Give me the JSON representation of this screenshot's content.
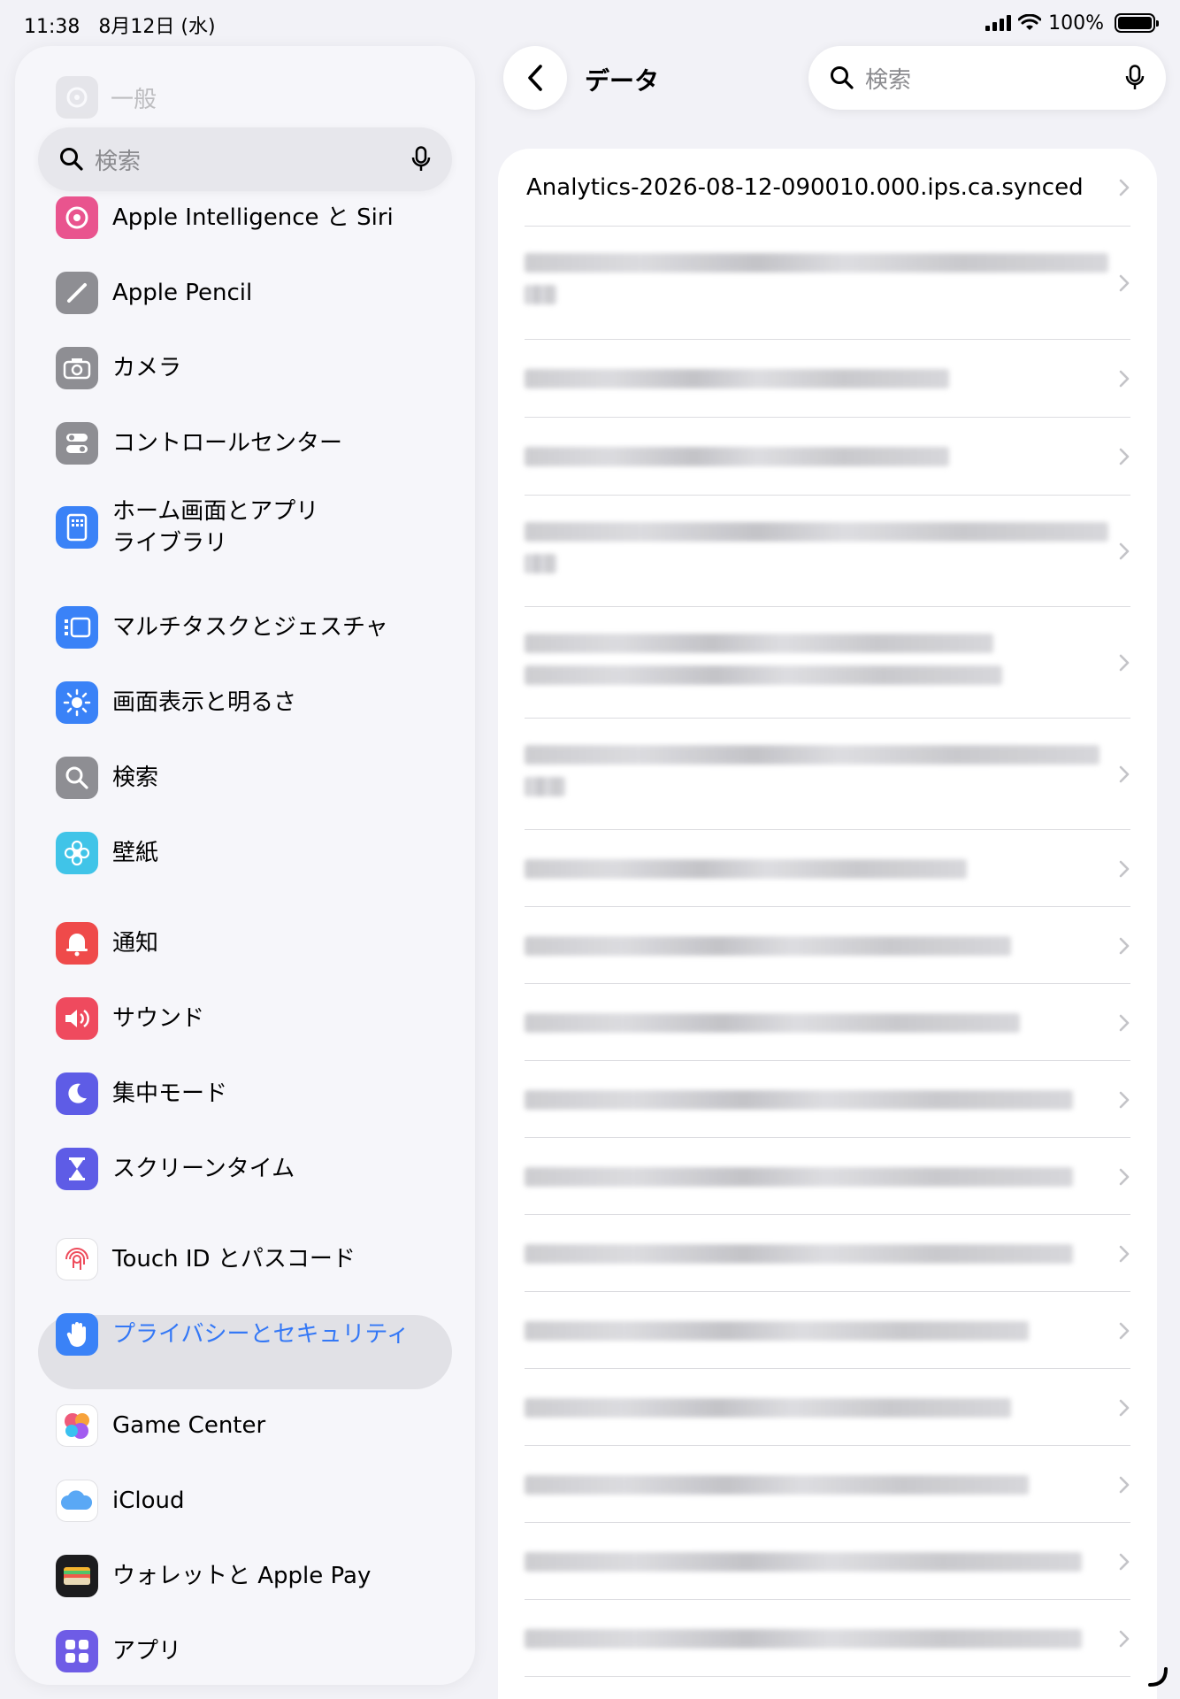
{
  "status_bar": {
    "time": "11:38",
    "date": "8月12日 (水)",
    "battery": "100%"
  },
  "sidebar": {
    "faded_item": "一般",
    "search_placeholder": "検索",
    "items": [
      {
        "label": "Apple Intelligence と Siri",
        "icon": "sparkle-icon",
        "color": "#e9548e"
      },
      {
        "label": "Apple Pencil",
        "icon": "pencil-icon",
        "color": "#8e8e93"
      },
      {
        "label": "カメラ",
        "icon": "camera-icon",
        "color": "#8e8e93"
      },
      {
        "label": "コントロールセンター",
        "icon": "toggles-icon",
        "color": "#8e8e93"
      },
      {
        "label": "ホーム画面とアプリ",
        "label2": "ライブラリ",
        "icon": "home-screen-icon",
        "color": "#3a82f7"
      },
      {
        "label": "マルチタスクとジェスチャ",
        "icon": "multitask-icon",
        "color": "#3a82f7"
      },
      {
        "label": "画面表示と明るさ",
        "icon": "sun-icon",
        "color": "#3a82f7"
      },
      {
        "label": "検索",
        "icon": "search-icon",
        "color": "#8e8e93"
      },
      {
        "label": "壁紙",
        "icon": "flower-icon",
        "color": "#40c4e8"
      },
      {
        "label": "通知",
        "icon": "bell-icon",
        "color": "#ef4a4a"
      },
      {
        "label": "サウンド",
        "icon": "speaker-icon",
        "color": "#ef4a5e"
      },
      {
        "label": "集中モード",
        "icon": "moon-icon",
        "color": "#5e5ce6"
      },
      {
        "label": "スクリーンタイム",
        "icon": "hourglass-icon",
        "color": "#5e5ce6"
      },
      {
        "label": "Touch ID とパスコード",
        "icon": "fingerprint-icon",
        "color": "#ffffff"
      },
      {
        "label": "プライバシーとセキュリティ",
        "icon": "hand-icon",
        "color": "#3a82f7",
        "selected": true
      },
      {
        "label": "Game Center",
        "icon": "game-center-icon",
        "color": "#ffffff"
      },
      {
        "label": "iCloud",
        "icon": "cloud-icon",
        "color": "#ffffff"
      },
      {
        "label": "ウォレットと Apple Pay",
        "icon": "wallet-icon",
        "color": "#1c1c1e"
      },
      {
        "label": "アプリ",
        "icon": "apps-icon",
        "color": "#6e5ce6"
      }
    ]
  },
  "nav": {
    "title": "データ",
    "search_placeholder": "検索"
  },
  "list": {
    "first_item": "Analytics-2026-08-12-090010.000.ips.ca.synced"
  },
  "colors": {
    "accent": "#3478f6",
    "background": "#f2f2f7"
  }
}
